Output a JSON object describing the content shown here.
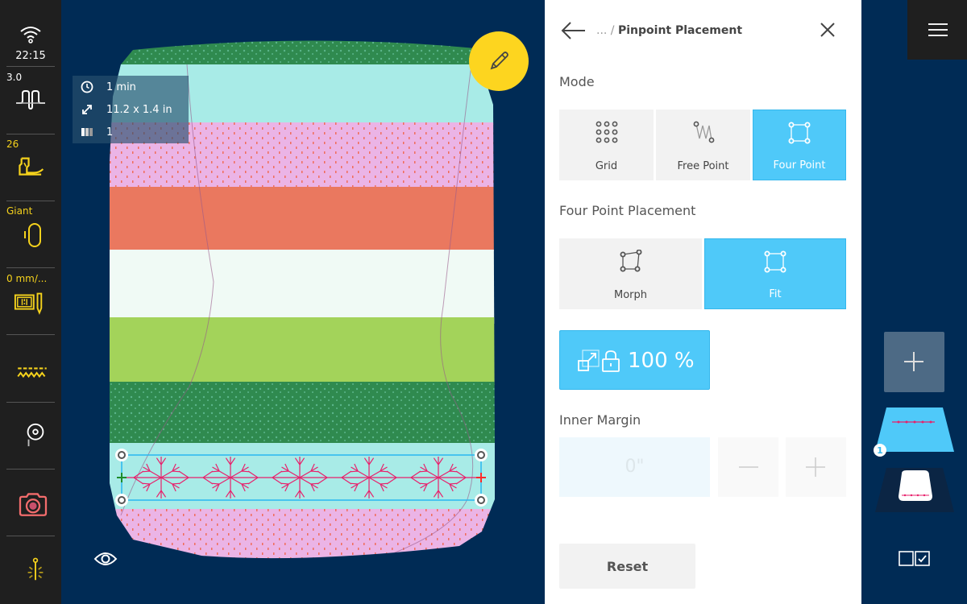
{
  "sidebar": {
    "time": "22:15",
    "items": [
      {
        "label": "3.0",
        "icon": "stitch-length-icon",
        "color": "#ffffff"
      },
      {
        "label": "26",
        "icon": "presser-foot-icon",
        "color": "#f5d21c"
      },
      {
        "label": "Giant",
        "icon": "hoop-icon",
        "color": "#f5d21c"
      },
      {
        "label": "0 mm/...",
        "icon": "needle-plate-icon",
        "color": "#f5d21c"
      },
      {
        "label": "",
        "icon": "zigzag-stitch-icon",
        "color": "#f5d21c"
      },
      {
        "label": "",
        "icon": "pin-location-icon",
        "color": "#ffffff"
      },
      {
        "label": "",
        "icon": "camera-icon",
        "color": "#f26c6c"
      },
      {
        "label": "",
        "icon": "needle-light-icon",
        "color": "#f5d21c"
      }
    ]
  },
  "canvas": {
    "info": {
      "time": "1 min",
      "size": "11.2 x 1.4 in",
      "colors": "1"
    },
    "edit_icon": "pencil-icon",
    "eye_icon": "eye-icon"
  },
  "panel": {
    "breadcrumb_ellipsis": "... /",
    "title": "Pinpoint Placement",
    "mode_title": "Mode",
    "modes": [
      {
        "label": "Grid",
        "active": false
      },
      {
        "label": "Free Point",
        "active": false
      },
      {
        "label": "Four Point",
        "active": true
      }
    ],
    "placement_title": "Four Point Placement",
    "placements": [
      {
        "label": "Morph",
        "active": false
      },
      {
        "label": "Fit",
        "active": true
      }
    ],
    "scale_value": "100 %",
    "inner_margin_title": "Inner Margin",
    "inner_margin_value": "0\"",
    "reset_label": "Reset"
  },
  "right_toolbar": {
    "layer_badge": "1"
  },
  "colors": {
    "accent": "#4fc9f9",
    "background": "#002b55",
    "sidebar": "#1f1f1f",
    "warning_yellow": "#fdd51f",
    "stitch_pink": "#e8206b"
  }
}
